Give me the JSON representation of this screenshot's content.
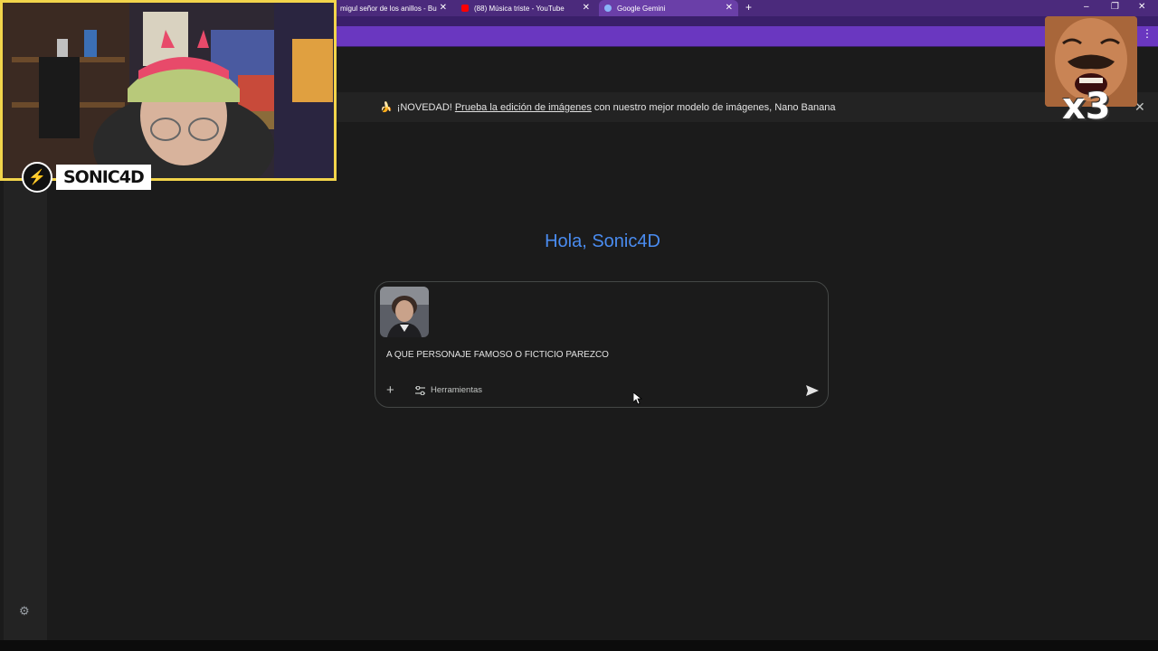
{
  "browser": {
    "tabs": [
      {
        "title": "migul señor de los anillos - Bu",
        "active": false
      },
      {
        "title": "(88) Música triste - YouTube",
        "active": false
      },
      {
        "title": "Google Gemini",
        "active": true
      }
    ],
    "new_tab": "+",
    "controls": {
      "minimize": "–",
      "restore": "❐",
      "close": "✕"
    },
    "menu": "⋮"
  },
  "banner": {
    "emoji": "🍌",
    "prefix": "¡NOVEDAD!",
    "link": "Prueba la edición de imágenes",
    "suffix": "con nuestro mejor modelo de imágenes, Nano Banana",
    "close": "✕"
  },
  "greeting": "Hola, Sonic4D",
  "composer": {
    "prompt": "A QUE PERSONAJE FAMOSO O FICTICIO PAREZCO",
    "plus": "+",
    "tools_label": "Herramientas"
  },
  "overlay": {
    "streamer_name": "SONIC4D",
    "reaction": "x3"
  },
  "colors": {
    "greeting": "#4a8cf0",
    "tabbar": "#4b2a7c",
    "cam_border": "#f2d44b"
  }
}
